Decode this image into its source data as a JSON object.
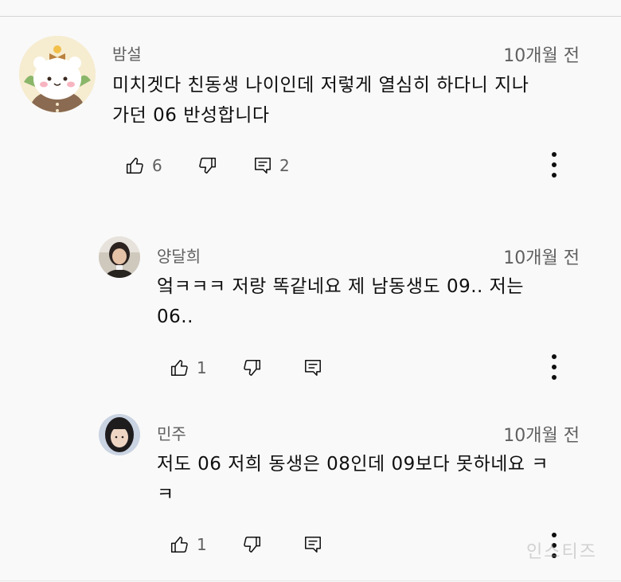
{
  "comments": [
    {
      "author": "밤설",
      "time": "10개월 전",
      "text_line1": "미치겟다 친동생 나이인데 저렇게 열심히 하다니 지나",
      "text_line2": "가던 06 반성합니다",
      "likes": "6",
      "replies": "2"
    },
    {
      "author": "양달희",
      "time": "10개월 전",
      "text_line1": "엌ㅋㅋㅋ 저랑 똑같네요 제 남동생도 09.. 저는",
      "text_line2": "06..",
      "likes": "1"
    },
    {
      "author": "민주",
      "time": "10개월 전",
      "text_line1": "저도 06 저희 동생은 08인데 09보다 못하네요 ㅋ",
      "text_line2": "ㅋ",
      "likes": "1"
    }
  ],
  "watermark": "인스티즈",
  "icons": {
    "like": "thumbs-up-icon",
    "dislike": "thumbs-down-icon",
    "reply": "reply-icon",
    "more": "more-vert-icon"
  },
  "colors": {
    "background": "#f9f9f9",
    "text": "#0f0f0f",
    "secondary": "#606060"
  }
}
